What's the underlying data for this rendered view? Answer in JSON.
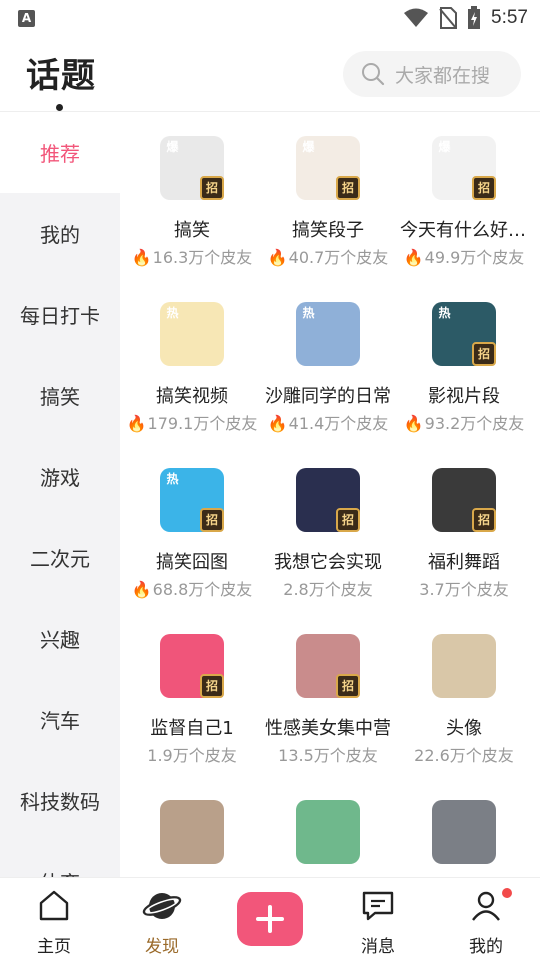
{
  "status_bar": {
    "time": "5:57",
    "app_badge": "A"
  },
  "header": {
    "title": "话题",
    "search_placeholder": "大家都在搜"
  },
  "sidebar": {
    "items": [
      {
        "label": "推荐",
        "active": true
      },
      {
        "label": "我的"
      },
      {
        "label": "每日打卡"
      },
      {
        "label": "搞笑"
      },
      {
        "label": "游戏"
      },
      {
        "label": "二次元"
      },
      {
        "label": "兴趣"
      },
      {
        "label": "汽车"
      },
      {
        "label": "科技数码"
      },
      {
        "label": "体育"
      }
    ]
  },
  "topics": [
    {
      "name": "搞笑",
      "stat": "16.3万个皮友",
      "hot": true,
      "badge": "爆",
      "recruit": "招",
      "color": "#e9e9e9"
    },
    {
      "name": "搞笑段子",
      "stat": "40.7万个皮友",
      "hot": true,
      "badge": "爆",
      "recruit": "招",
      "color": "#f3ece4"
    },
    {
      "name": "今天有什么好看的",
      "stat": "49.9万个皮友",
      "hot": true,
      "badge": "爆",
      "recruit": "招",
      "color": "#f2f2f2"
    },
    {
      "name": "搞笑视频",
      "stat": "179.1万个皮友",
      "hot": true,
      "badge": "热",
      "recruit": "",
      "color": "#f7e7b5"
    },
    {
      "name": "沙雕同学的日常",
      "stat": "41.4万个皮友",
      "hot": true,
      "badge": "热",
      "recruit": "",
      "color": "#8fb0d8"
    },
    {
      "name": "影视片段",
      "stat": "93.2万个皮友",
      "hot": true,
      "badge": "热",
      "recruit": "招",
      "color": "#2c5a66"
    },
    {
      "name": "搞笑囧图",
      "stat": "68.8万个皮友",
      "hot": true,
      "badge": "热",
      "recruit": "招",
      "color": "#3bb4e8"
    },
    {
      "name": "我想它会实现",
      "stat": "2.8万个皮友",
      "hot": false,
      "badge": "",
      "recruit": "招",
      "color": "#2a2f4f"
    },
    {
      "name": "福利舞蹈",
      "stat": "3.7万个皮友",
      "hot": false,
      "badge": "",
      "recruit": "招",
      "color": "#3a3a3a"
    },
    {
      "name": "监督自己1",
      "stat": "1.9万个皮友",
      "hot": false,
      "badge": "",
      "recruit": "招",
      "color": "#f0557a"
    },
    {
      "name": "性感美女集中营",
      "stat": "13.5万个皮友",
      "hot": false,
      "badge": "",
      "recruit": "招",
      "color": "#c98c8c"
    },
    {
      "name": "头像",
      "stat": "22.6万个皮友",
      "hot": false,
      "badge": "",
      "recruit": "",
      "color": "#d9c7a8"
    },
    {
      "name": "",
      "stat": "",
      "hot": false,
      "badge": "",
      "recruit": "",
      "color": "#b9a08a"
    },
    {
      "name": "",
      "stat": "",
      "hot": false,
      "badge": "",
      "recruit": "",
      "color": "#6fb88c"
    },
    {
      "name": "",
      "stat": "",
      "hot": false,
      "badge": "",
      "recruit": "",
      "color": "#7b7f86"
    }
  ],
  "bottom_nav": {
    "home": "主页",
    "discover": "发现",
    "messages": "消息",
    "me": "我的"
  },
  "colors": {
    "accent": "#f2567a",
    "discover_active": "#9a6a2a"
  },
  "icons": [
    "wifi-icon",
    "no-sim-icon",
    "battery-charging-icon",
    "search-icon",
    "home-icon",
    "planet-icon",
    "plus-icon",
    "message-icon",
    "profile-icon",
    "fire-icon"
  ]
}
